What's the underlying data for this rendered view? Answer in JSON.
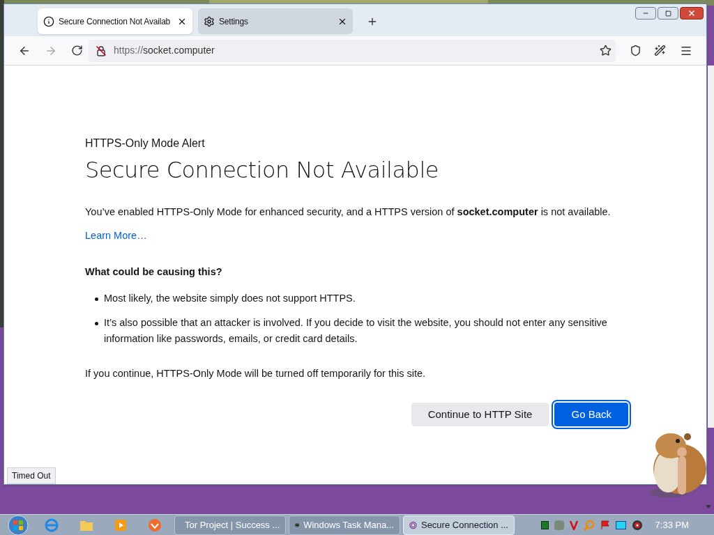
{
  "tabs": [
    {
      "title": "Secure Connection Not Availab",
      "selected": true
    },
    {
      "title": "Settings",
      "selected": false
    }
  ],
  "address": {
    "scheme": "https://",
    "host": "socket.computer"
  },
  "page": {
    "kicker": "HTTPS-Only Mode Alert",
    "title": "Secure Connection Not Available",
    "intro": "You’ve enabled HTTPS-Only Mode for enhanced security, and a HTTPS version of **socket.computer** is not available.",
    "link": "Learn More…",
    "causes_heading": "What could be causing this?",
    "causes": [
      "Most likely, the website simply does not support HTTPS.",
      "It’s also possible that an attacker is involved. If you decide to visit the website, you should not enter any sensitive information like passwords, emails, or credit card details."
    ],
    "note": "If you continue, HTTPS-Only Mode will be turned off temporarily for this site.",
    "buttons": [
      {
        "label": "Continue to HTTP Site",
        "kind": "secondary"
      },
      {
        "label": "Go Back",
        "kind": "primary"
      }
    ]
  },
  "status": "Timed Out",
  "taskbar": {
    "tasks": [
      {
        "label": "Tor Project | Success ...",
        "selected": false
      },
      {
        "label": "Windows Task Mana...",
        "selected": false
      },
      {
        "label": "Secure Connection ...",
        "selected": true
      }
    ],
    "time": "7:33 PM"
  }
}
